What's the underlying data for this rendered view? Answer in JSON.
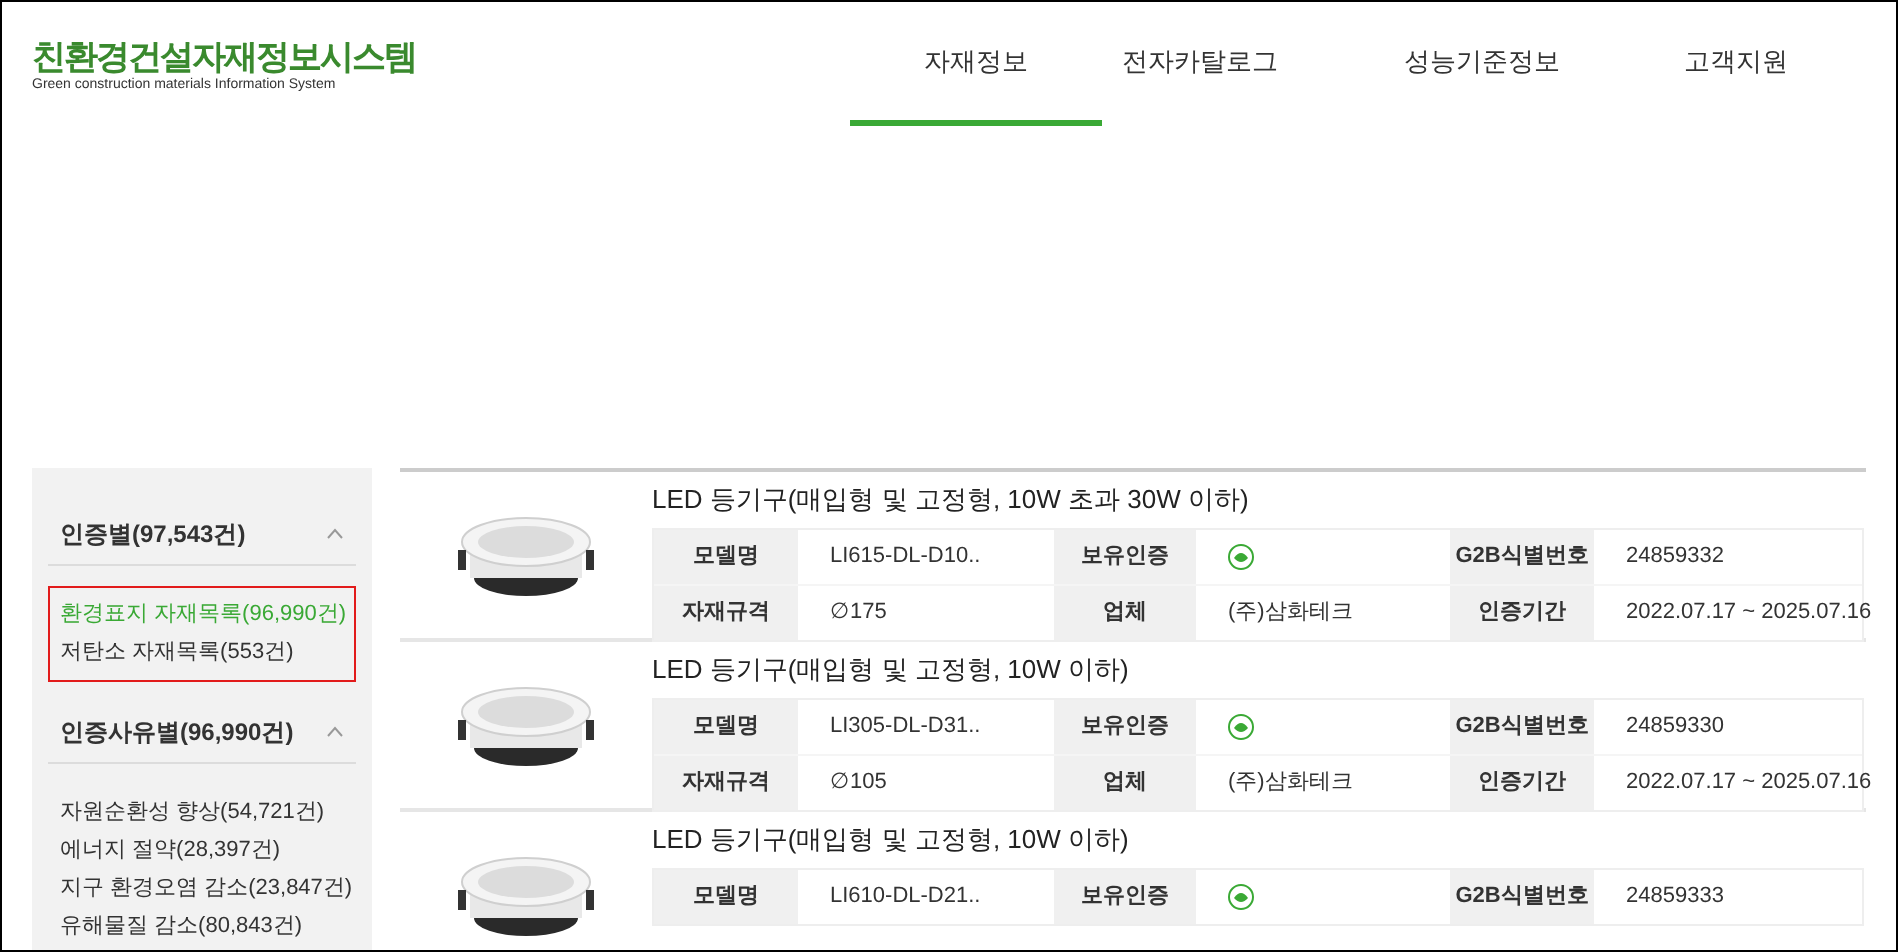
{
  "logo": {
    "title": "친환경건설자재정보시스템",
    "subtitle": "Green construction materials Information System"
  },
  "nav": [
    {
      "label": "자재정보",
      "selected": true
    },
    {
      "label": "전자카탈로그",
      "selected": false
    },
    {
      "label": "성능기준정보",
      "selected": false
    },
    {
      "label": "고객지원",
      "selected": false
    }
  ],
  "sidebar": {
    "groups": [
      {
        "title": "인증별(97,543건)",
        "expanded": true,
        "highlighted": true,
        "items": [
          {
            "label": "환경표지 자재목록(96,990건)",
            "selected": true
          },
          {
            "label": "저탄소 자재목록(553건)",
            "selected": false
          }
        ]
      },
      {
        "title": "인증사유별(96,990건)",
        "expanded": true,
        "highlighted": false,
        "items": [
          {
            "label": "자원순환성 향상(54,721건)",
            "selected": false
          },
          {
            "label": "에너지 절약(28,397건)",
            "selected": false
          },
          {
            "label": "지구 환경오염 감소(23,847건)",
            "selected": false
          },
          {
            "label": "유해물질 감소(80,843건)",
            "selected": false
          }
        ]
      }
    ]
  },
  "products": [
    {
      "title": "LED 등기구(매입형 및 고정형, 10W 초과 30W 이하)",
      "image": {
        "kind": "picture"
      },
      "fields": [
        {
          "label": "모델명",
          "value": "LI615-DL-D10.."
        },
        {
          "label": "보유인증",
          "kind": "cert"
        },
        {
          "label": "G2B식별번호",
          "value": "24859332"
        },
        {
          "label": "자재규격",
          "value": "∅175"
        },
        {
          "label": "업체",
          "value": "(주)삼화테크"
        },
        {
          "label": "인증기간",
          "value": "2022.07.17 ~ 2025.07.16"
        }
      ]
    },
    {
      "title": "LED 등기구(매입형 및 고정형, 10W 이하)",
      "image": {
        "kind": "picture"
      },
      "fields": [
        {
          "label": "모델명",
          "value": "LI305-DL-D31.."
        },
        {
          "label": "보유인증",
          "kind": "cert"
        },
        {
          "label": "G2B식별번호",
          "value": "24859330"
        },
        {
          "label": "자재규격",
          "value": "∅105"
        },
        {
          "label": "업체",
          "value": "(주)삼화테크"
        },
        {
          "label": "인증기간",
          "value": "2022.07.17 ~ 2025.07.16"
        }
      ]
    },
    {
      "title": "LED 등기구(매입형 및 고정형, 10W 이하)",
      "image": {
        "kind": "picture"
      },
      "fields": [
        {
          "label": "모델명",
          "value": "LI610-DL-D21.."
        },
        {
          "label": "보유인증",
          "kind": "cert"
        },
        {
          "label": "G2B식별번호",
          "value": "24859333"
        }
      ]
    }
  ]
}
